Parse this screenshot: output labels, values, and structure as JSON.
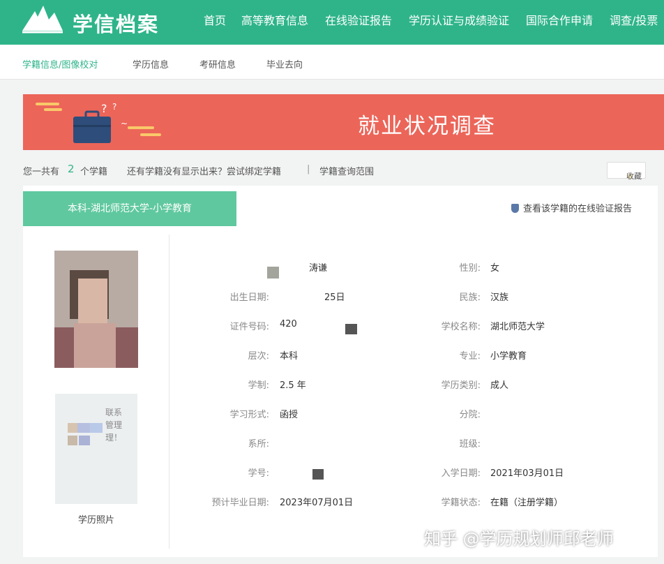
{
  "header": {
    "brand": "学信档案",
    "nav": [
      "首页",
      "高等教育信息",
      "在线验证报告",
      "学历认证与成绩验证",
      "国际合作申请",
      "调查/投票"
    ]
  },
  "subnav": {
    "items": [
      "学籍信息/图像校对",
      "学历信息",
      "考研信息",
      "毕业去向"
    ]
  },
  "banner": {
    "title": "就业状况调查"
  },
  "summary": {
    "prefix": "您一共有",
    "count": "2",
    "suffix": "个学籍",
    "hint": "还有学籍没有显示出来？尝试绑定学籍",
    "separator": "|",
    "scope_link": "学籍查询范围",
    "favorite": "收藏"
  },
  "record": {
    "tab_label": "本科-湖北师范大学-小学教育",
    "verify_link": "查看该学籍的在线验证报告",
    "photo_caption": "学历照片",
    "photo_text": "联系\n管理\n理！",
    "left_fields": [
      {
        "label": "",
        "value": "涛谦"
      },
      {
        "label": "出生日期:",
        "value": "25日"
      },
      {
        "label": "证件号码:",
        "value": "420"
      },
      {
        "label": "层次:",
        "value": "本科"
      },
      {
        "label": "学制:",
        "value": "2.5 年"
      },
      {
        "label": "学习形式:",
        "value": "函授"
      },
      {
        "label": "系所:",
        "value": ""
      },
      {
        "label": "学号:",
        "value": ""
      },
      {
        "label": "预计毕业日期:",
        "value": "2023年07月01日"
      }
    ],
    "right_fields": [
      {
        "label": "性别:",
        "value": "女"
      },
      {
        "label": "民族:",
        "value": "汉族"
      },
      {
        "label": "学校名称:",
        "value": "湖北师范大学"
      },
      {
        "label": "专业:",
        "value": "小学教育"
      },
      {
        "label": "学历类别:",
        "value": "成人"
      },
      {
        "label": "分院:",
        "value": ""
      },
      {
        "label": "班级:",
        "value": ""
      },
      {
        "label": "入学日期:",
        "value": "2021年03月01日"
      },
      {
        "label": "学籍状态:",
        "value": "在籍（注册学籍）"
      }
    ]
  },
  "watermark": "知乎 @学历规划师邱老师",
  "colors": {
    "primary": "#2fb48a",
    "tab": "#5fc89f",
    "banner": "#ec6559"
  }
}
